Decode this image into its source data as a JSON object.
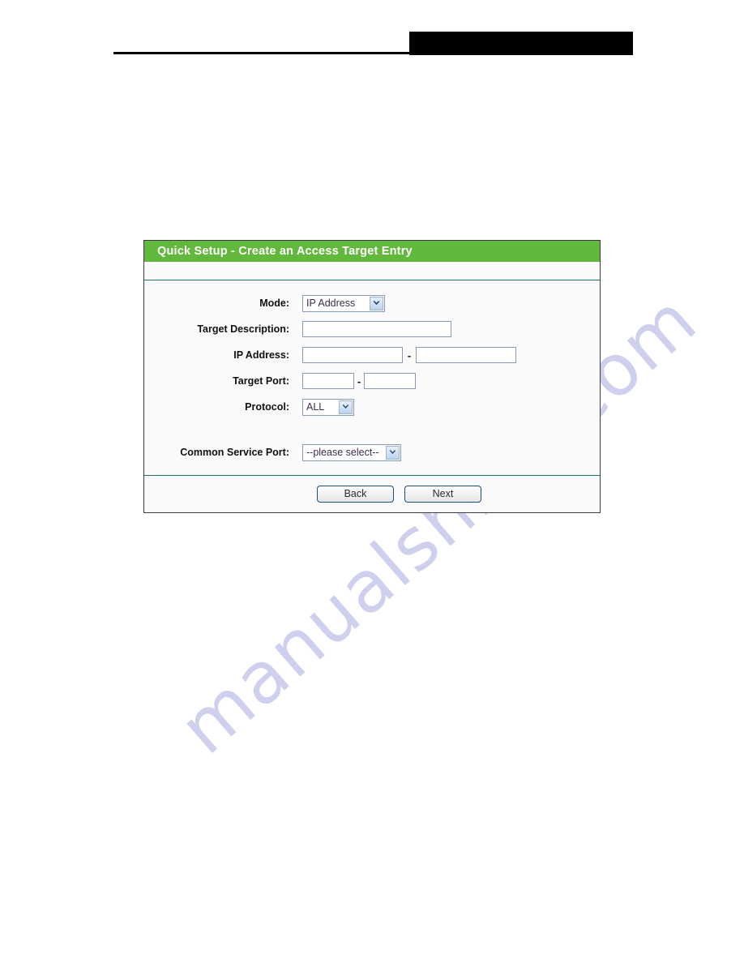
{
  "page": {
    "watermark_text": "manualshive.com",
    "header": {
      "redaction_label": "",
      "rule_label": ""
    }
  },
  "panel": {
    "title": "Quick Setup - Create an Access Target Entry",
    "colors": {
      "title_bar": "#62b83c",
      "divider": "#1f7a4d",
      "panel_border": "#3c3c3c",
      "body_background": "#fafafa",
      "field_border": "#8a9ab5",
      "button_border": "#1d4f78",
      "watermark": "#c7c8ec"
    },
    "fields": {
      "mode": {
        "label": "Mode:",
        "selected": "IP Address",
        "icon": "chevron-down-icon"
      },
      "target_description": {
        "label": "Target Description:",
        "value": "",
        "placeholder": ""
      },
      "ip_address": {
        "label": "IP Address:",
        "start_value": "",
        "end_value": "",
        "separator": "-"
      },
      "target_port": {
        "label": "Target Port:",
        "start_value": "",
        "end_value": "",
        "separator": "-"
      },
      "protocol": {
        "label": "Protocol:",
        "selected": "ALL",
        "icon": "chevron-down-icon"
      },
      "common_service_port": {
        "label": "Common Service Port:",
        "selected": "--please select--",
        "icon": "chevron-down-icon"
      }
    },
    "footer": {
      "back_label": "Back",
      "next_label": "Next"
    }
  }
}
